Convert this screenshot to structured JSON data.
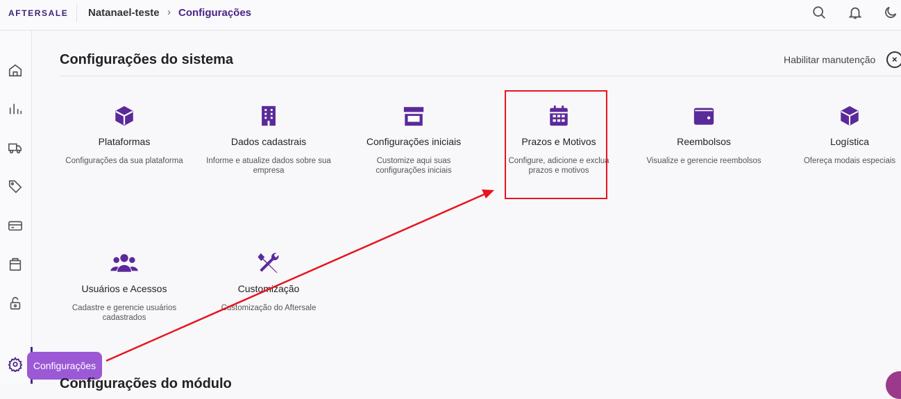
{
  "header": {
    "logo": "AFTERSALE",
    "breadcrumb_account": "Natanael-teste",
    "breadcrumb_separator": "›",
    "breadcrumb_current": "Configurações",
    "icons": [
      "search-icon",
      "bell-icon",
      "moon-icon"
    ]
  },
  "sidebar": {
    "icons": [
      "home-icon",
      "chart-bars-icon",
      "truck-icon",
      "tag-icon",
      "credit-card-icon",
      "package-icon",
      "lock-icon",
      "gear-icon"
    ],
    "tooltip": "Configurações"
  },
  "main": {
    "title": "Configurações do sistema",
    "maintenance_label": "Habilitar manutenção",
    "maintenance_toggle": "×",
    "cards": [
      {
        "title": "Plataformas",
        "desc": "Configurações da sua plataforma",
        "icon": "box-icon"
      },
      {
        "title": "Dados cadastrais",
        "desc": "Informe e atualize dados sobre sua empresa",
        "icon": "building-icon"
      },
      {
        "title": "Configurações iniciais",
        "desc": "Customize aqui suas configurações iniciais",
        "icon": "store-icon"
      },
      {
        "title": "Prazos e Motivos",
        "desc": "Configure, adicione e exclua prazos e motivos",
        "icon": "calendar-icon"
      },
      {
        "title": "Reembolsos",
        "desc": "Visualize e gerencie reembolsos",
        "icon": "wallet-icon"
      },
      {
        "title": "Logística",
        "desc": "Ofereça modais especiais",
        "icon": "cube-icon"
      },
      {
        "title": "Usuários e Acessos",
        "desc": "Cadastre e gerencie usuários cadastrados",
        "icon": "users-icon"
      },
      {
        "title": "Customização",
        "desc": "Customização do Aftersale",
        "icon": "tools-icon"
      }
    ],
    "next_section": "Configurações do módulo"
  },
  "colors": {
    "accent": "#4a2488",
    "icon": "#5a2a9a",
    "highlight": "#e8141e",
    "tooltip": "#9b59d6"
  }
}
